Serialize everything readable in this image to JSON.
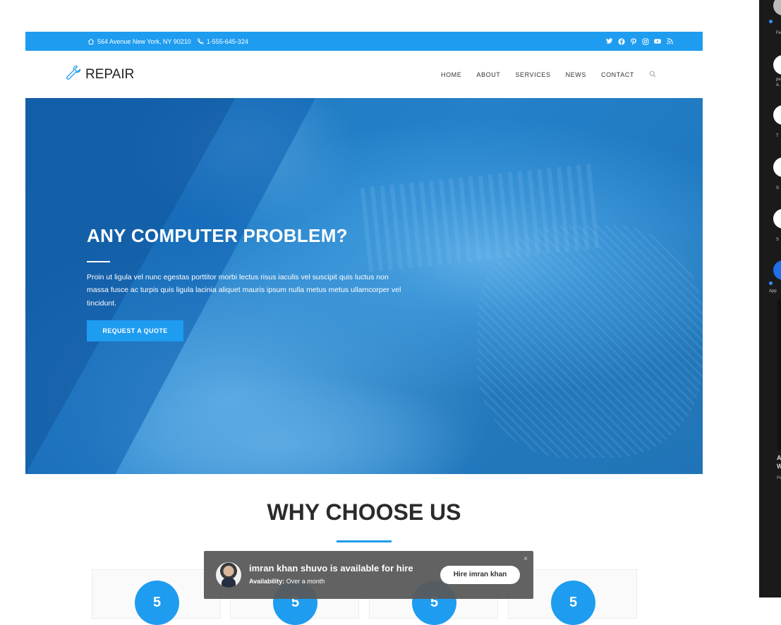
{
  "topbar": {
    "address": "564 Avenue New York, NY 90210",
    "phone": "1-555-645-324",
    "social_icons": [
      "twitter-icon",
      "facebook-icon",
      "pinterest-icon",
      "instagram-icon",
      "youtube-icon",
      "rss-icon"
    ]
  },
  "header": {
    "logo_text": "REPAIR",
    "nav": [
      "HOME",
      "ABOUT",
      "SERVICES",
      "NEWS",
      "CONTACT"
    ]
  },
  "hero": {
    "title": "ANY COMPUTER PROBLEM?",
    "text": "Proin ut ligula vel nunc egestas porttitor morbi lectus risus iaculis vel suscipit quis luctus non massa fusce ac turpis quis ligula lacinia aliquet mauris ipsum nulla metus metus ullamcorper vel tincidunt.",
    "button": "REQUEST A QUOTE"
  },
  "why": {
    "title": "WHY CHOOSE US",
    "cards": [
      "5",
      "5",
      "5",
      "5"
    ]
  },
  "popup": {
    "name": "imran khan shuvo is available for hire",
    "availability_label": "Availability:",
    "availability_value": "Over a month",
    "button": "Hire imran khan",
    "close": "×"
  },
  "side_panel": {
    "labels": [
      "Fe",
      "pe",
      "A.",
      "T",
      "S",
      "S",
      "App"
    ],
    "captions": [
      "A",
      "W",
      "Pe"
    ]
  },
  "colors": {
    "accent": "#1e9cf0",
    "hero_overlay": "#1f6fbe",
    "popup_bg": "#5a5a5a"
  }
}
